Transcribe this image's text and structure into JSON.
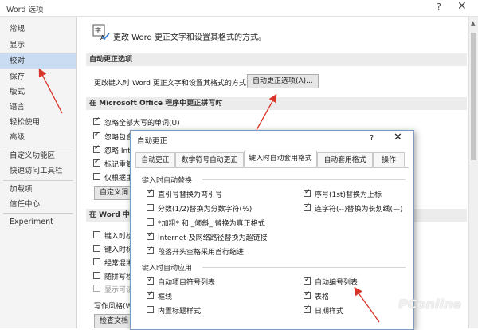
{
  "window": {
    "title": "Word 选项",
    "help": "?",
    "close": "✕"
  },
  "sidebar": {
    "items": [
      {
        "label": "常规"
      },
      {
        "label": "显示"
      },
      {
        "label": "校对"
      },
      {
        "label": "保存"
      },
      {
        "label": "版式"
      },
      {
        "label": "语言"
      },
      {
        "label": "轻松使用"
      },
      {
        "label": "高级"
      },
      {
        "label": "自定义功能区"
      },
      {
        "label": "快速访问工具栏"
      },
      {
        "label": "加载项"
      },
      {
        "label": "信任中心"
      },
      {
        "label": "Experiment"
      }
    ]
  },
  "main": {
    "header": "更改 Word 更正文字和设置其格式的方式。",
    "autocorrect_section": "自动更正选项",
    "autocorrect_desc": "更改键入时 Word 更正文字和设置其格式的方式:",
    "autocorrect_button": "自动更正选项(A)...",
    "office_section": "在 Microsoft Office 程序中更正拼写时",
    "office_checks": [
      {
        "label": "忽略全部大写的单词(U)"
      },
      {
        "label": "忽略包含"
      },
      {
        "label": "忽略 Inte"
      },
      {
        "label": "标记重复"
      },
      {
        "label": "仅根据主"
      }
    ],
    "custom_dict_button": "自定义词",
    "word_section": "在 Word 中更",
    "word_checks": [
      {
        "label": "键入时检"
      },
      {
        "label": "键入时标"
      },
      {
        "label": "经常混淆"
      },
      {
        "label": "随拼写检"
      },
      {
        "label": "显示可读"
      }
    ],
    "style_label": "写作风格(W",
    "check_doc_button": "检查文档"
  },
  "dialog": {
    "title": "自动更正",
    "help": "?",
    "close": "✕",
    "tabs": [
      "自动更正",
      "数学符号自动更正",
      "键入时自动套用格式",
      "自动套用格式",
      "操作"
    ],
    "replace_group": "键入时自动替换",
    "replace_items": [
      {
        "label": "直引号替换为弯引号",
        "checked": true
      },
      {
        "label": "序号(1st)替换为上标",
        "checked": true
      },
      {
        "label": "分数(1/2)替换为分数字符(½)",
        "checked": false
      },
      {
        "label": "连字符(--)替换为长划线(—)",
        "checked": true
      },
      {
        "label": "*加粗* 和 _倾斜_ 替换为真正格式",
        "checked": false
      },
      {
        "label": "Internet 及网络路径替换为超链接",
        "checked": true
      },
      {
        "label": "段落开头空格采用首行缩进",
        "checked": true
      }
    ],
    "apply_group": "键入时自动应用",
    "apply_items": [
      {
        "label": "自动项目符号列表",
        "checked": true
      },
      {
        "label": "自动编号列表",
        "checked": true
      },
      {
        "label": "框线",
        "checked": true
      },
      {
        "label": "表格",
        "checked": true
      },
      {
        "label": "内置标题样式",
        "checked": false
      },
      {
        "label": "日期样式",
        "checked": true
      }
    ]
  },
  "watermark": "PConline",
  "colors": {
    "selected": "#c9dcf2",
    "arrow": "#d9332a"
  }
}
